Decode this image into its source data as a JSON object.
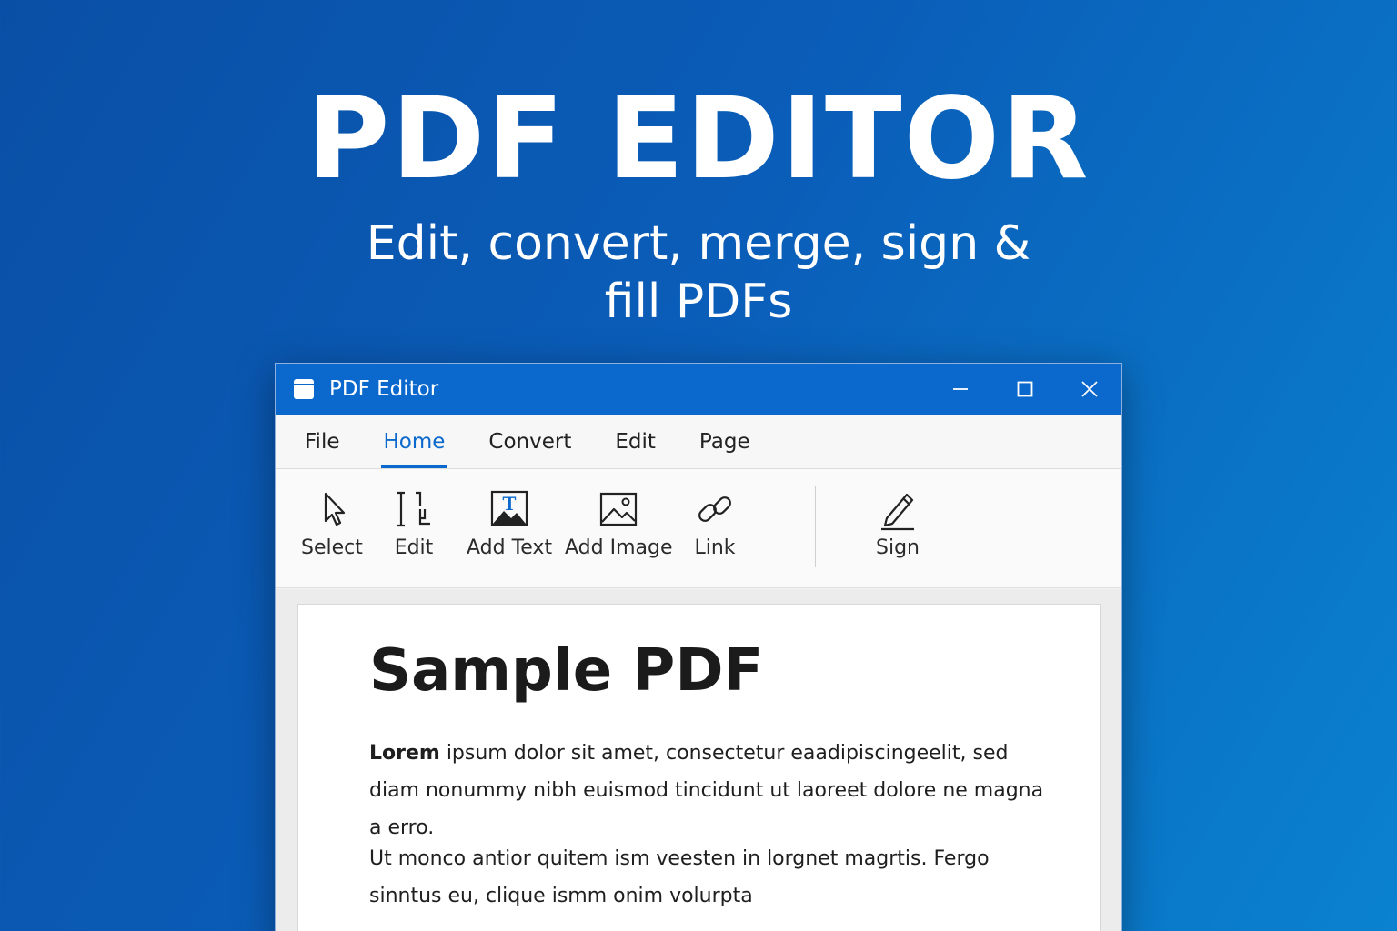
{
  "hero": {
    "title": "PDF EDITOR",
    "subtitle": "Edit, convert, merge, sign & fill PDFs"
  },
  "window": {
    "title": "PDF Editor",
    "controls": [
      "minimize-icon",
      "maximize-icon",
      "close-icon"
    ]
  },
  "menu": {
    "items": [
      {
        "label": "File"
      },
      {
        "label": "Home",
        "active": true
      },
      {
        "label": "Convert"
      },
      {
        "label": "Edit"
      },
      {
        "label": "Page"
      }
    ]
  },
  "ribbon": {
    "tools": [
      {
        "label": "Select",
        "icon": "cursor-icon"
      },
      {
        "label": "Edit",
        "icon": "text-cursor-icon"
      },
      {
        "label": "Add Text",
        "icon": "add-text-icon"
      },
      {
        "label": "Add Image",
        "icon": "image-icon"
      },
      {
        "label": "Link",
        "icon": "link-icon"
      },
      {
        "label": "Sign",
        "icon": "pen-icon"
      }
    ]
  },
  "document": {
    "title": "Sample PDF",
    "p1_bold": "Lorem",
    "p1_rest": " ipsum dolor sit amet, consectetur eaadipiscingeelit, sed diam nonummy nibh euismod tincidunt ut laoreet dolore ne magna a erro.",
    "p2": "Ut monco antior quitem ism veesten in lorgnet magrtis. Fergo sinntus eu, clique ismm onim volurpta"
  },
  "colors": {
    "accent": "#0b68cc",
    "background_start": "#0a4fa6",
    "background_end": "#0a82cf"
  }
}
